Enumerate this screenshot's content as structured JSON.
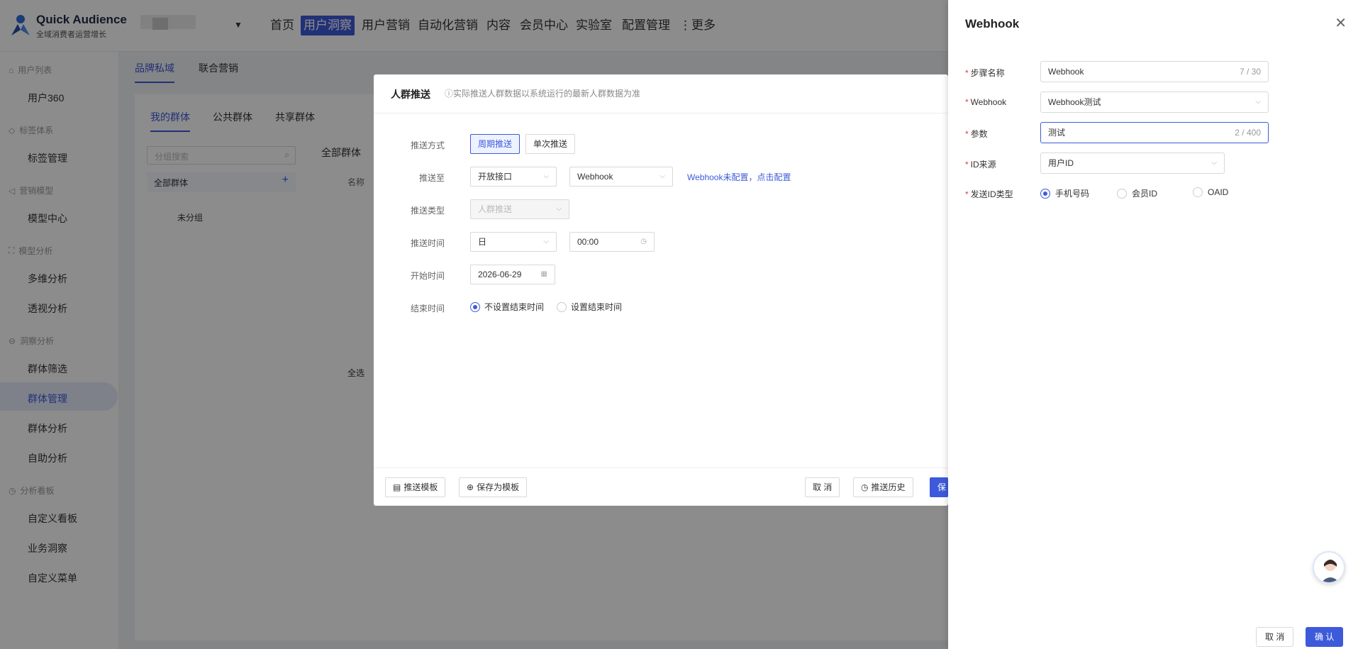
{
  "brand": {
    "title": "Quick Audience",
    "subtitle": "全域消费者运营增长"
  },
  "nav": {
    "items": [
      "首页",
      "用户洞察",
      "用户营销",
      "自动化营销",
      "内容",
      "会员中心",
      "实验室",
      "配置管理",
      "⋮更多"
    ],
    "active": "用户洞察"
  },
  "sidebar": {
    "groups": [
      {
        "title": "用户列表",
        "items": [
          "用户360"
        ]
      },
      {
        "title": "标签体系",
        "items": [
          "标签管理"
        ]
      },
      {
        "title": "营销模型",
        "items": [
          "模型中心"
        ]
      },
      {
        "title": "模型分析",
        "items": [
          "多维分析",
          "透视分析"
        ]
      },
      {
        "title": "洞察分析",
        "items": [
          "群体筛选",
          "群体管理",
          "群体分析",
          "自助分析"
        ]
      },
      {
        "title": "分析看板",
        "items": [
          "自定义看板",
          "业务洞察",
          "自定义菜单"
        ]
      }
    ],
    "active_item": "群体管理"
  },
  "content": {
    "top_tabs": [
      "品牌私域",
      "联合营销"
    ],
    "sub_tabs": [
      "我的群体",
      "公共群体",
      "共享群体"
    ],
    "group_search_placeholder": "分组搜索",
    "tree": [
      "全部群体",
      "未分组"
    ],
    "panel_title": "全部群体",
    "col_name": "名称",
    "select_all": "全选"
  },
  "modal": {
    "title": "人群推送",
    "hint": "ⓘ实际推送人群数据以系统运行的最新人群数据为准",
    "push_mode_label": "推送方式",
    "push_modes": [
      "周期推送",
      "单次推送"
    ],
    "push_to_label": "推送至",
    "push_to_value": "开放接口",
    "push_channel_value": "Webhook",
    "push_link": "Webhook未配置，点击配置",
    "push_type_label": "推送类型",
    "push_type_placeholder": "人群推送",
    "push_time_label": "推送时间",
    "push_time_unit": "日",
    "push_time_value": "00:00",
    "start_time_label": "开始时间",
    "start_time_value": "2026-06-29",
    "end_time_label": "结束时间",
    "end_options": [
      "不设置结束时间",
      "设置结束时间"
    ],
    "footer": {
      "template_btn": "推送模板",
      "save_template_btn": "保存为模板",
      "cancel_btn": "取 消",
      "history_btn": "推送历史",
      "save_btn": "保"
    }
  },
  "drawer": {
    "title": "Webhook",
    "fields": {
      "step_name_label": "步骤名称",
      "step_name_value": "Webhook",
      "step_name_count": "7 / 30",
      "webhook_label": "Webhook",
      "webhook_value": "Webhook测试",
      "param_label": "参数",
      "param_value": "测试",
      "param_count": "2 / 400",
      "id_source_label": "ID来源",
      "id_source_value": "用户ID",
      "send_id_type_label": "发送ID类型",
      "send_id_types": [
        "手机号码",
        "会员ID",
        "OAID"
      ],
      "send_id_selected": "手机号码"
    },
    "footer": {
      "cancel": "取 消",
      "confirm": "确 认"
    }
  },
  "colors": {
    "accent": "#3d5adb",
    "required": "#e4393c"
  }
}
